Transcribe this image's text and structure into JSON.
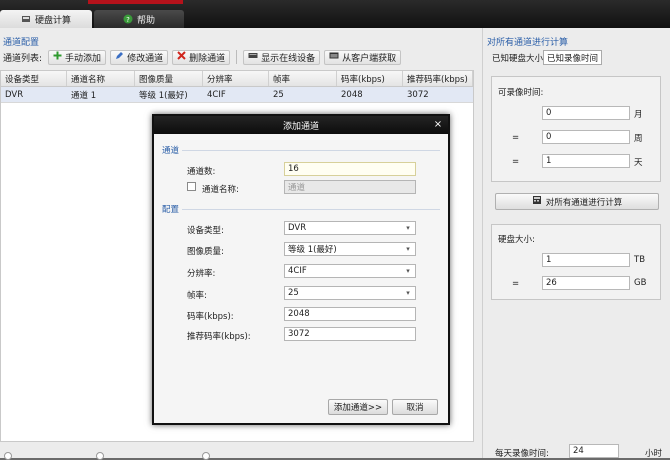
{
  "topbar": {
    "tabs": [
      {
        "label": "硬盘计算",
        "icon": "disk-icon"
      },
      {
        "label": "帮助",
        "icon": "help-icon"
      }
    ]
  },
  "left": {
    "section_label": "通道配置",
    "toolbar": {
      "list_label": "通道列表:",
      "buttons": [
        {
          "label": "手动添加",
          "icon": "plus-icon"
        },
        {
          "label": "修改通道",
          "icon": "pencil-icon"
        },
        {
          "label": "删除通道",
          "icon": "delete-icon"
        },
        {
          "label": "显示在线设备",
          "icon": "device-icon"
        },
        {
          "label": "从客户端获取",
          "icon": "folder-icon"
        }
      ]
    },
    "table": {
      "columns": [
        "设备类型",
        "通道名称",
        "图像质量",
        "分辨率",
        "帧率",
        "码率(kbps)",
        "推荐码率(kbps)"
      ],
      "rows": [
        [
          "DVR",
          "通道 1",
          "等级 1(最好)",
          "4CIF",
          "25",
          "2048",
          "3072"
        ]
      ]
    }
  },
  "right": {
    "title": "对所有通道进行计算",
    "tabs": [
      "已知硬盘大小",
      "已知录像时间"
    ],
    "record_time": {
      "title": "可录像时间:",
      "months": "0",
      "months_unit": "月",
      "weeks": "0",
      "weeks_unit": "周",
      "days": "1",
      "days_unit": "天",
      "eq": "="
    },
    "calc_button": "对所有通道进行计算",
    "disk_size": {
      "title": "硬盘大小:",
      "tb": "1",
      "tb_unit": "TB",
      "gb": "26",
      "gb_unit": "GB",
      "eq": "="
    },
    "daily": {
      "label": "每天录像时间:",
      "value": "24",
      "unit": "小时"
    }
  },
  "modal": {
    "title": "添加通道",
    "close": "×",
    "section_channel": "通道",
    "channel_count_label": "通道数:",
    "channel_count_value": "16",
    "channel_name_label": "通道名称:",
    "channel_name_placeholder": "通道",
    "section_config": "配置",
    "device_type_label": "设备类型:",
    "device_type_value": "DVR",
    "quality_label": "图像质量:",
    "quality_value": "等级 1(最好)",
    "resolution_label": "分辨率:",
    "resolution_value": "4CIF",
    "fps_label": "帧率:",
    "fps_value": "25",
    "bitrate_label": "码率(kbps):",
    "bitrate_value": "2048",
    "rec_bitrate_label": "推荐码率(kbps):",
    "rec_bitrate_value": "3072",
    "add_button": "添加通道>>",
    "cancel_button": "取消"
  },
  "colors": {
    "accent_blue": "#2a5ea8",
    "titlebar_dark": "#111111",
    "brand_red": "#b5121b"
  }
}
